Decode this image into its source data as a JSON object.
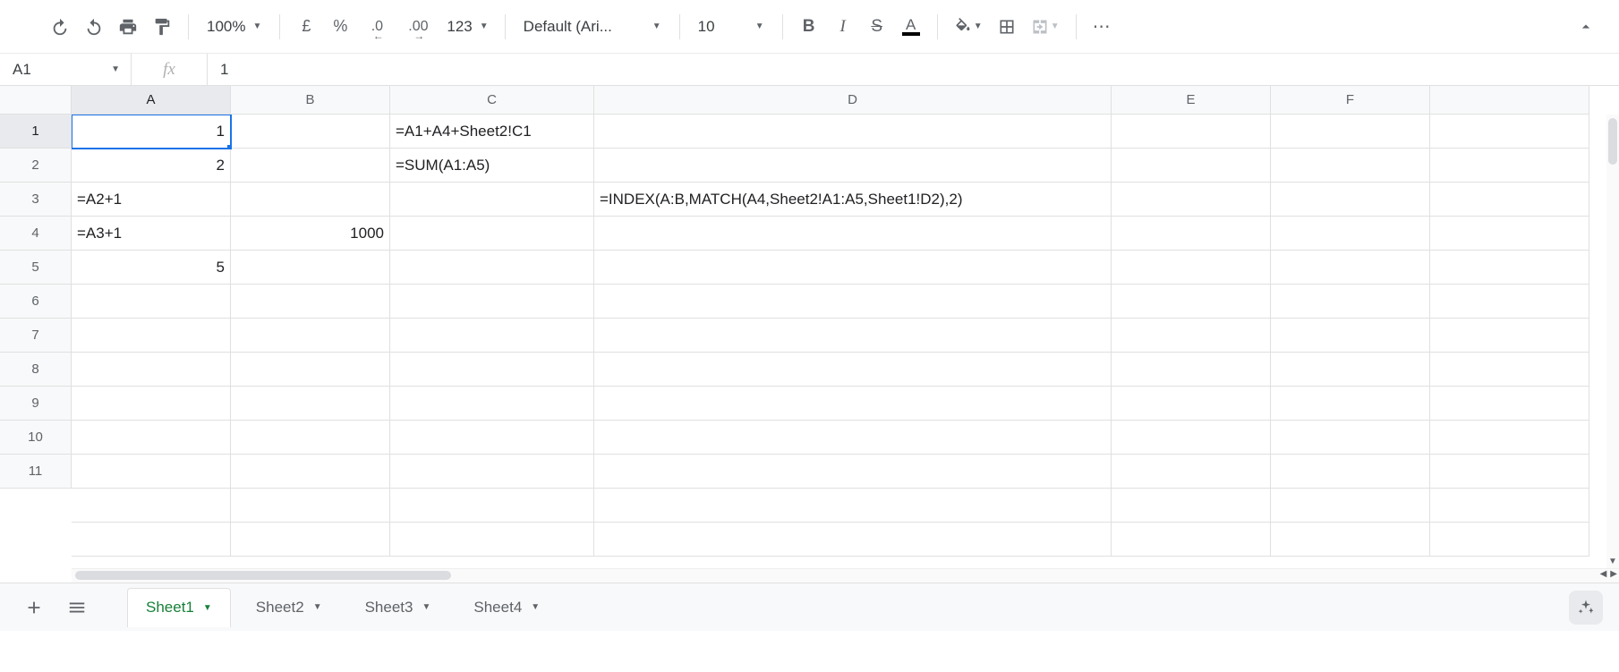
{
  "toolbar": {
    "zoom": "100%",
    "currency": "£",
    "percent": "%",
    "dec_dec": ".0",
    "dec_inc": ".00",
    "more_formats": "123",
    "font": "Default (Ari...",
    "font_size": "10",
    "more": "⋯"
  },
  "name_box": "A1",
  "formula_value": "1",
  "columns": [
    "A",
    "B",
    "C",
    "D",
    "E",
    "F"
  ],
  "rows": [
    "1",
    "2",
    "3",
    "4",
    "5",
    "6",
    "7",
    "8",
    "9",
    "10",
    "11"
  ],
  "selected_cell": "A1",
  "cells": {
    "A1": {
      "v": "1",
      "align": "r"
    },
    "A2": {
      "v": "2",
      "align": "r"
    },
    "A3": {
      "v": "=A2+1",
      "align": "l"
    },
    "A4": {
      "v": "=A3+1",
      "align": "l"
    },
    "A5": {
      "v": "5",
      "align": "r"
    },
    "B4": {
      "v": "1000",
      "align": "r"
    },
    "C1": {
      "v": "=A1+A4+Sheet2!C1",
      "align": "l"
    },
    "C2": {
      "v": "=SUM(A1:A5)",
      "align": "l"
    },
    "D3": {
      "v": "=INDEX(A:B,MATCH(A4,Sheet2!A1:A5,Sheet1!D2),2)",
      "align": "l"
    }
  },
  "sheets": {
    "active": "Sheet1",
    "tabs": [
      "Sheet1",
      "Sheet2",
      "Sheet3",
      "Sheet4"
    ]
  }
}
